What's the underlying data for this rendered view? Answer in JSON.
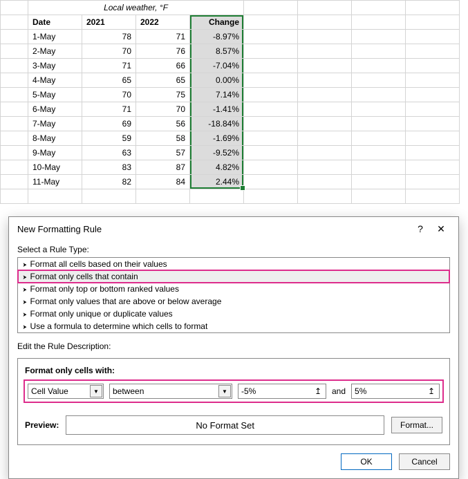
{
  "sheet": {
    "title": "Local weather, °F",
    "headers": {
      "date": "Date",
      "y2021": "2021",
      "y2022": "2022",
      "change": "Change"
    },
    "rows": [
      {
        "date": "1-May",
        "y2021": "78",
        "y2022": "71",
        "change": "-8.97%"
      },
      {
        "date": "2-May",
        "y2021": "70",
        "y2022": "76",
        "change": "8.57%"
      },
      {
        "date": "3-May",
        "y2021": "71",
        "y2022": "66",
        "change": "-7.04%"
      },
      {
        "date": "4-May",
        "y2021": "65",
        "y2022": "65",
        "change": "0.00%"
      },
      {
        "date": "5-May",
        "y2021": "70",
        "y2022": "75",
        "change": "7.14%"
      },
      {
        "date": "6-May",
        "y2021": "71",
        "y2022": "70",
        "change": "-1.41%"
      },
      {
        "date": "7-May",
        "y2021": "69",
        "y2022": "56",
        "change": "-18.84%"
      },
      {
        "date": "8-May",
        "y2021": "59",
        "y2022": "58",
        "change": "-1.69%"
      },
      {
        "date": "9-May",
        "y2021": "63",
        "y2022": "57",
        "change": "-9.52%"
      },
      {
        "date": "10-May",
        "y2021": "83",
        "y2022": "87",
        "change": "4.82%"
      },
      {
        "date": "11-May",
        "y2021": "82",
        "y2022": "84",
        "change": "2.44%"
      }
    ]
  },
  "dialog": {
    "title": "New Formatting Rule",
    "help": "?",
    "close": "✕",
    "selectLabel": "Select a Rule Type:",
    "ruleTypes": [
      "Format all cells based on their values",
      "Format only cells that contain",
      "Format only top or bottom ranked values",
      "Format only values that are above or below average",
      "Format only unique or duplicate values",
      "Use a formula to determine which cells to format"
    ],
    "selectedRuleIndex": 1,
    "editLabel": "Edit the Rule Description:",
    "descLabel": "Format only cells with:",
    "cellValue": "Cell Value",
    "operator": "between",
    "valueLow": "-5%",
    "and": "and",
    "valueHigh": "5%",
    "previewLabel": "Preview:",
    "previewText": "No Format Set",
    "formatBtn": "Format...",
    "ok": "OK",
    "cancel": "Cancel"
  },
  "chart_data": {
    "type": "table",
    "title": "Local weather, °F",
    "columns": [
      "Date",
      "2021",
      "2022",
      "Change"
    ],
    "rows": [
      [
        "1-May",
        78,
        71,
        -8.97
      ],
      [
        "2-May",
        70,
        76,
        8.57
      ],
      [
        "3-May",
        71,
        66,
        -7.04
      ],
      [
        "4-May",
        65,
        65,
        0.0
      ],
      [
        "5-May",
        70,
        75,
        7.14
      ],
      [
        "6-May",
        71,
        70,
        -1.41
      ],
      [
        "7-May",
        69,
        56,
        -18.84
      ],
      [
        "8-May",
        59,
        58,
        -1.69
      ],
      [
        "9-May",
        63,
        57,
        -9.52
      ],
      [
        "10-May",
        83,
        87,
        4.82
      ],
      [
        "11-May",
        82,
        84,
        2.44
      ]
    ],
    "change_unit": "%"
  }
}
